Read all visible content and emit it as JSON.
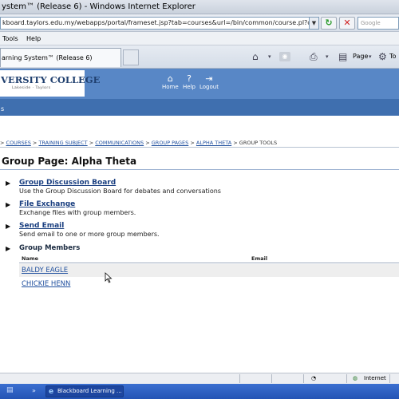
{
  "window": {
    "title": "ystem™ (Release 6) - Windows Internet Explorer"
  },
  "address_bar": {
    "url": "kboard.taylors.edu.my/webapps/portal/frameset.jsp?tab=courses&url=/bin/common/course.pl?course_id=_4",
    "search_placeholder": "Google"
  },
  "menu": {
    "items": [
      "Tools",
      "Help"
    ]
  },
  "tab": {
    "label": "arning System™ (Release 6)"
  },
  "toolbar": {
    "page_label": "Page",
    "tools_label": "To"
  },
  "header": {
    "logo_text": "VERSITY COLLEGE",
    "logo_sub": "Lakeside · Taylors",
    "buttons": [
      {
        "label": "Home",
        "icon": "house-icon"
      },
      {
        "label": "Help",
        "icon": "help-icon"
      },
      {
        "label": "Logout",
        "icon": "logout-icon"
      }
    ],
    "active_tab": "s"
  },
  "breadcrumb": {
    "items": [
      "COURSES",
      "TRAINING SUBJECT",
      "COMMUNICATIONS",
      "GROUP PAGES",
      "ALPHA THETA"
    ],
    "current": "GROUP TOOLS",
    "separator": ">"
  },
  "page": {
    "heading": "Group Page: Alpha Theta"
  },
  "tools": [
    {
      "title": "Group Discussion Board",
      "description": "Use the Group Discussion Board for debates and conversations"
    },
    {
      "title": "File Exchange",
      "description": "Exchange files with group members."
    },
    {
      "title": "Send Email",
      "description": "Send email to one or more group members."
    }
  ],
  "members": {
    "title": "Group Members",
    "columns": [
      "Name",
      "Email"
    ],
    "rows": [
      {
        "name": "BALDY EAGLE",
        "email": ""
      },
      {
        "name": "CHICKIE HENN",
        "email": ""
      }
    ]
  },
  "statusbar": {
    "zone": "Internet"
  },
  "taskbar": {
    "item_label": "Blackboard Learning ..."
  },
  "colors": {
    "header_blue": "#5887c6",
    "subbar_blue": "#3f6faf",
    "link_blue": "#1f4f9e"
  }
}
